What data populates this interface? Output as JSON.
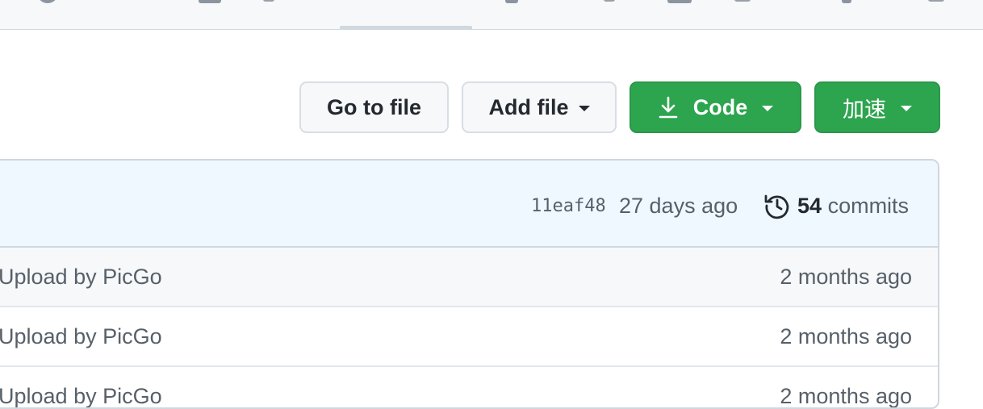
{
  "nav": {
    "icons": [
      "circle-icon",
      "book-icon",
      "pencil-icon",
      "graph-icon",
      "gear-icon"
    ]
  },
  "toolbar": {
    "go_to_file": "Go to file",
    "add_file": "Add file",
    "code": "Code",
    "speedup": "加速"
  },
  "latest_commit": {
    "sha": "11eaf48",
    "age": "27 days ago",
    "commit_count": "54",
    "commits_label": "commits"
  },
  "files": [
    {
      "message": "Upload by PicGo",
      "age": "2 months ago"
    },
    {
      "message": "Upload by PicGo",
      "age": "2 months ago"
    },
    {
      "message": "Upload by PicGo",
      "age": "2 months ago"
    }
  ],
  "colors": {
    "primary": "#2da44e",
    "header_bg": "#eff8ff"
  }
}
